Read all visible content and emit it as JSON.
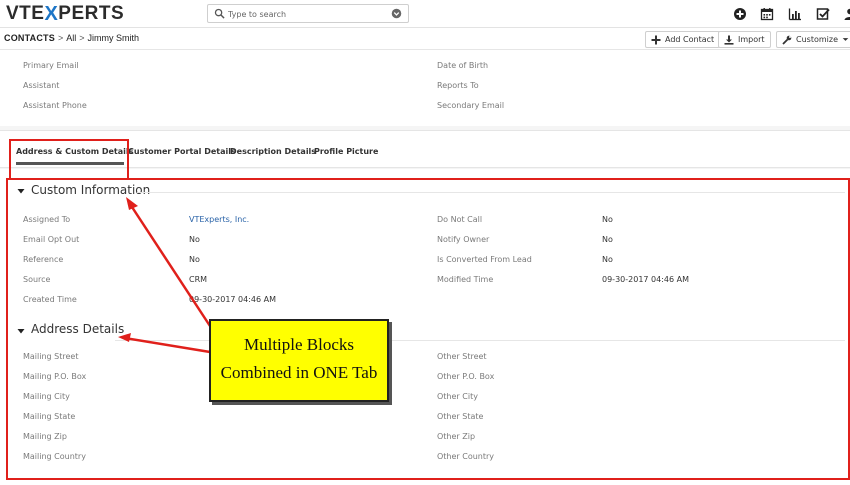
{
  "header": {
    "logo": {
      "part1": "VTE",
      "part2": "X",
      "part3": "PERTS"
    },
    "search_placeholder": "Type to search",
    "icons": [
      "plus-circle-icon",
      "calendar-icon",
      "chart-icon",
      "checkbox-icon"
    ]
  },
  "breadcrumb": {
    "module": "CONTACTS",
    "sep1": ">",
    "filter": "All",
    "sep2": ">",
    "record": "Jimmy Smith"
  },
  "actions": {
    "add_contact": "Add Contact",
    "import": "Import",
    "customize": "Customize"
  },
  "summary": {
    "left": [
      "Primary Email",
      "Assistant",
      "Assistant Phone"
    ],
    "right": [
      "Date of Birth",
      "Reports To",
      "Secondary Email"
    ]
  },
  "tabs": [
    {
      "label": "Address & Custom Details",
      "active": true
    },
    {
      "label": "Customer Portal Details",
      "active": false
    },
    {
      "label": "Description Details",
      "active": false
    },
    {
      "label": "Profile Picture",
      "active": false
    }
  ],
  "custom_block": {
    "title": "Custom Information",
    "rows": [
      {
        "l_label": "Assigned To",
        "l_value": "VTExperts, Inc.",
        "r_label": "Do Not Call",
        "r_value": "No"
      },
      {
        "l_label": "Email Opt Out",
        "l_value": "No",
        "r_label": "Notify Owner",
        "r_value": "No"
      },
      {
        "l_label": "Reference",
        "l_value": "No",
        "r_label": "Is Converted From Lead",
        "r_value": "No"
      },
      {
        "l_label": "Source",
        "l_value": "CRM",
        "r_label": "Modified Time",
        "r_value": "09-30-2017 04:46 AM"
      },
      {
        "l_label": "Created Time",
        "l_value": "09-30-2017 04:46 AM",
        "r_label": "",
        "r_value": ""
      }
    ]
  },
  "address_block": {
    "title": "Address Details",
    "rows": [
      {
        "l_label": "Mailing Street",
        "r_label": "Other Street"
      },
      {
        "l_label": "Mailing P.O. Box",
        "r_label": "Other P.O. Box"
      },
      {
        "l_label": "Mailing City",
        "r_label": "Other City"
      },
      {
        "l_label": "Mailing State",
        "r_label": "Other State"
      },
      {
        "l_label": "Mailing Zip",
        "r_label": "Other Zip"
      },
      {
        "l_label": "Mailing Country",
        "r_label": "Other Country"
      }
    ]
  },
  "callout": {
    "line1": "Multiple Blocks",
    "line2": "Combined in ONE  Tab"
  },
  "colors": {
    "accent_blue": "#1d76c7",
    "link": "#2a63a8",
    "annotation_red": "#e0201b",
    "callout_bg": "#ffff00"
  }
}
